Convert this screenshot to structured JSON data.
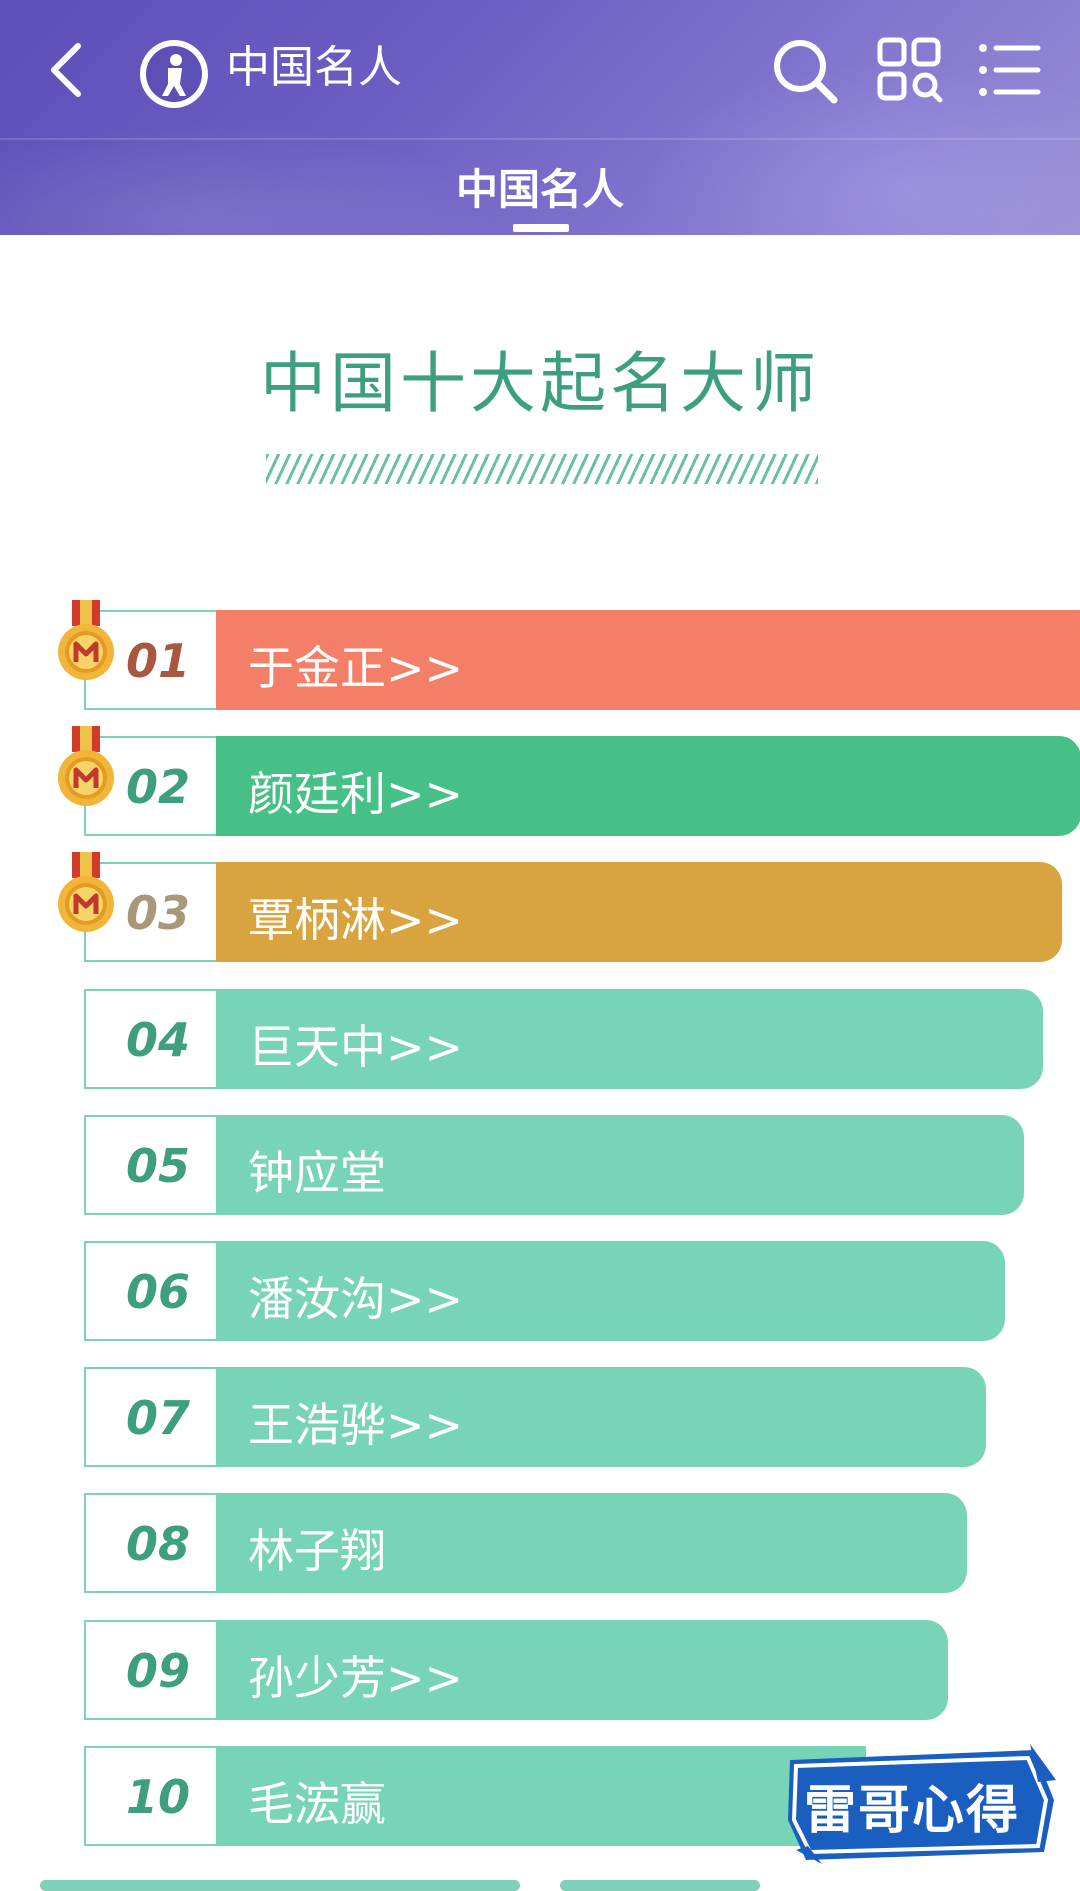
{
  "header": {
    "site_title": "中国名人",
    "tab_label": "中国名人"
  },
  "page": {
    "heading": "中国十大起名大师"
  },
  "list": [
    {
      "rank": "01",
      "name": "于金正>>",
      "color": "#f47f68",
      "num_color": "#a8583e",
      "medal": true
    },
    {
      "rank": "02",
      "name": "颜廷利>>",
      "color": "#46c086",
      "num_color": "#3e9e80",
      "medal": true
    },
    {
      "rank": "03",
      "name": "覃柄淋>>",
      "color": "#d9a43f",
      "num_color": "#a8987a",
      "medal": true
    },
    {
      "rank": "04",
      "name": "巨天中>>",
      "color": "#78d4b6",
      "num_color": "#3e9e80",
      "medal": false
    },
    {
      "rank": "05",
      "name": "钟应堂",
      "color": "#78d4b6",
      "num_color": "#3e9e80",
      "medal": false
    },
    {
      "rank": "06",
      "name": "潘汝沟>>",
      "color": "#78d4b6",
      "num_color": "#3e9e80",
      "medal": false
    },
    {
      "rank": "07",
      "name": "王浩骅>>",
      "color": "#78d4b6",
      "num_color": "#3e9e80",
      "medal": false
    },
    {
      "rank": "08",
      "name": "林子翔",
      "color": "#78d4b6",
      "num_color": "#3e9e80",
      "medal": false
    },
    {
      "rank": "09",
      "name": "孙少芳>>",
      "color": "#78d4b6",
      "num_color": "#3e9e80",
      "medal": false
    },
    {
      "rank": "10",
      "name": "毛浤赢",
      "color": "#78d4b6",
      "num_color": "#3e9e80",
      "medal": false
    }
  ],
  "badge": {
    "text": "雷哥心得"
  },
  "icons": {
    "back": "chevron-left-icon",
    "logo": "maigoo-logo-icon",
    "search": "search-icon",
    "grid": "grid-icon",
    "menu": "list-menu-icon",
    "medal": "medal-icon"
  },
  "colors": {
    "header_bg": "#6a5dc2",
    "heading": "#3e9e80",
    "teal_bar": "#78d4b6"
  }
}
